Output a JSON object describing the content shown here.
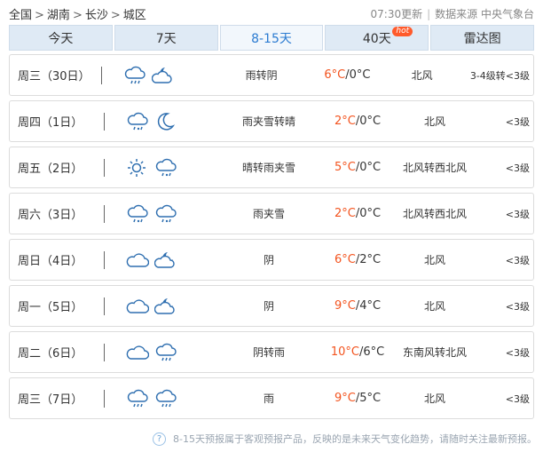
{
  "breadcrumb": {
    "items": [
      "全国",
      "湖南",
      "长沙",
      "城区"
    ],
    "separator": ">"
  },
  "source": {
    "update_time": "07:30更新",
    "separator": "|",
    "label": "数据来源 中央气象台"
  },
  "tabs": [
    {
      "label": "今天",
      "active": false
    },
    {
      "label": "7天",
      "active": false
    },
    {
      "label": "8-15天",
      "active": true
    },
    {
      "label": "40天",
      "active": false,
      "badge": "hot"
    },
    {
      "label": "雷达图",
      "active": false
    }
  ],
  "forecast": [
    {
      "day": "周三（30日）",
      "icon_day": "rain-icon",
      "icon_night": "cloudy-moon-icon",
      "desc": "雨转阴",
      "high": "6°C",
      "low": "/0°C",
      "wind": "北风",
      "level": "3-4级转<3级"
    },
    {
      "day": "周四（1日）",
      "icon_day": "sleet-icon",
      "icon_night": "moon-icon",
      "desc": "雨夹雪转晴",
      "high": "2°C",
      "low": "/0°C",
      "wind": "北风",
      "level": "<3级"
    },
    {
      "day": "周五（2日）",
      "icon_day": "sun-icon",
      "icon_night": "sleet-icon",
      "desc": "晴转雨夹雪",
      "high": "5°C",
      "low": "/0°C",
      "wind": "北风转西北风",
      "level": "<3级"
    },
    {
      "day": "周六（3日）",
      "icon_day": "sleet-icon",
      "icon_night": "sleet-icon",
      "desc": "雨夹雪",
      "high": "2°C",
      "low": "/0°C",
      "wind": "北风转西北风",
      "level": "<3级"
    },
    {
      "day": "周日（4日）",
      "icon_day": "overcast-icon",
      "icon_night": "cloudy-moon-icon",
      "desc": "阴",
      "high": "6°C",
      "low": "/2°C",
      "wind": "北风",
      "level": "<3级"
    },
    {
      "day": "周一（5日）",
      "icon_day": "overcast-icon",
      "icon_night": "cloudy-moon-icon",
      "desc": "阴",
      "high": "9°C",
      "low": "/4°C",
      "wind": "北风",
      "level": "<3级"
    },
    {
      "day": "周二（6日）",
      "icon_day": "overcast-icon",
      "icon_night": "rain-icon",
      "desc": "阴转雨",
      "high": "10°C",
      "low": "/6°C",
      "wind": "东南风转北风",
      "level": "<3级"
    },
    {
      "day": "周三（7日）",
      "icon_day": "rain-icon",
      "icon_night": "rain-icon",
      "desc": "雨",
      "high": "9°C",
      "low": "/5°C",
      "wind": "北风",
      "level": "<3级"
    }
  ],
  "footer": {
    "help_icon": "question-icon",
    "help_glyph": "?",
    "note": "8-15天预报属于客观预报产品，反映的是未来天气变化趋势，请随时关注最新预报。"
  },
  "colors": {
    "accent": "#2b7bd1",
    "high_temp": "#f3541f",
    "icon_blue": "#2f6fb0",
    "hot_badge": "#ff5a2b"
  }
}
